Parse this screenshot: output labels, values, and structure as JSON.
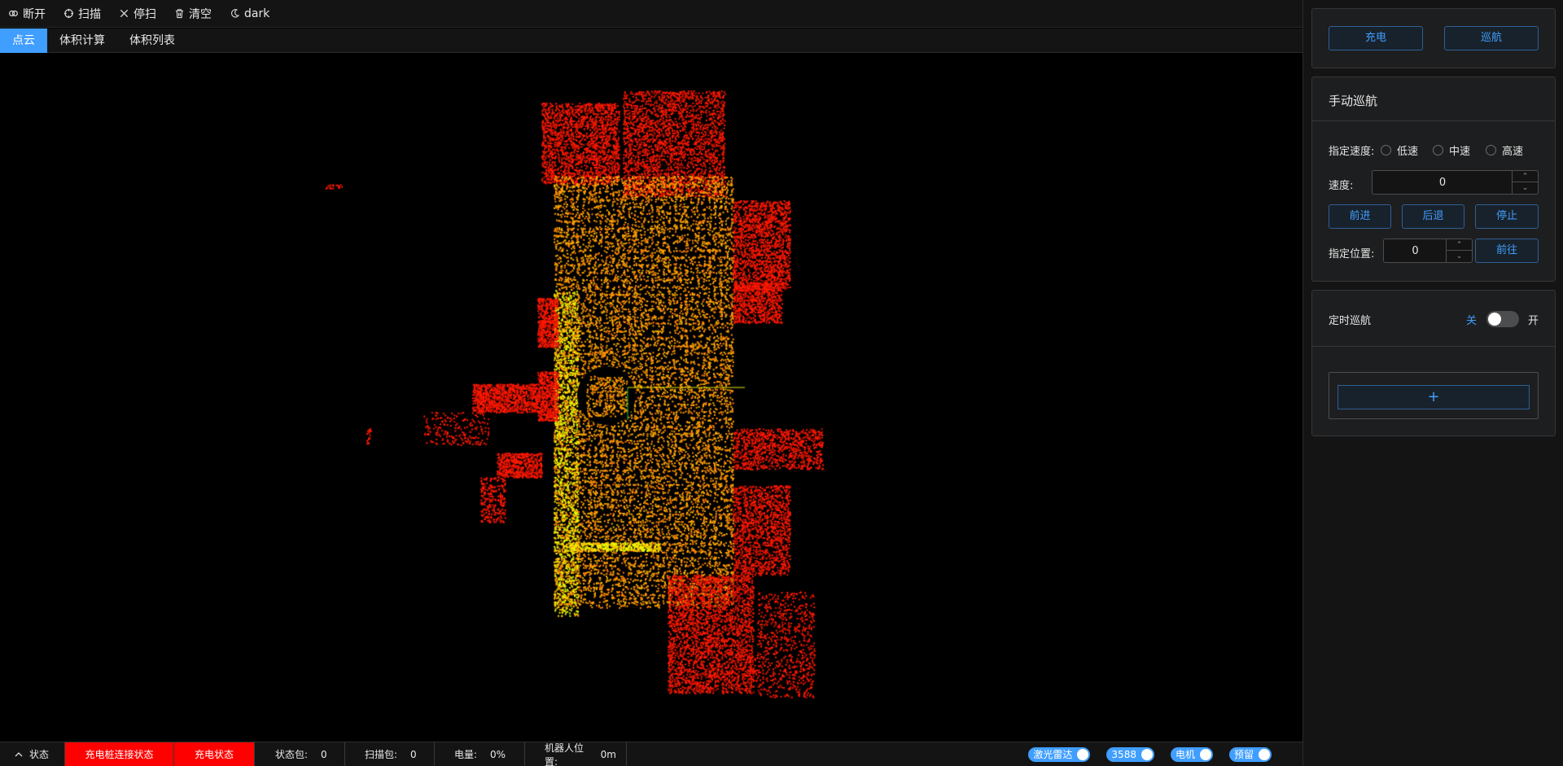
{
  "toolbar": {
    "items": [
      {
        "label": "断开",
        "icon": "disconnect-icon"
      },
      {
        "label": "扫描",
        "icon": "scan-icon"
      },
      {
        "label": "停扫",
        "icon": "close-icon"
      },
      {
        "label": "清空",
        "icon": "trash-icon"
      },
      {
        "label": "dark",
        "icon": "moon-icon"
      }
    ]
  },
  "tabs": [
    {
      "label": "点云",
      "active": true
    },
    {
      "label": "体积计算",
      "active": false
    },
    {
      "label": "体积列表",
      "active": false
    }
  ],
  "colors": {
    "accent": "#409eff",
    "alert": "#ff0000",
    "panel_bg": "#141414",
    "card_bg": "#1d1e1f",
    "point_cloud_low": "#ff1a00",
    "point_cloud_mid": "#ff9900",
    "point_cloud_high": "#e6ff00"
  },
  "statusbar": {
    "toggle_label": "状态",
    "charge_dock_status": "充电桩连接状态",
    "charge_status": "充电状态",
    "status_packet_label": "状态包:",
    "status_packet_value": "0",
    "scan_packet_label": "扫描包:",
    "scan_packet_value": "0",
    "battery_label": "电量:",
    "battery_value": "0%",
    "robot_position_label": "机器人位置:",
    "robot_position_value": "0m",
    "switches": [
      "激光雷达",
      "3588",
      "电机",
      "预留"
    ]
  },
  "panel": {
    "charge_button": "充电",
    "patrol_button": "巡航",
    "manual": {
      "title": "手动巡航",
      "speed_preset_label": "指定速度:",
      "speed_options": [
        "低速",
        "中速",
        "高速"
      ],
      "speed_label": "速度:",
      "speed_value": "0",
      "forward_button": "前进",
      "backward_button": "后退",
      "stop_button": "停止",
      "position_label": "指定位置:",
      "position_value": "0",
      "goto_button": "前往"
    },
    "timed": {
      "title": "定时巡航",
      "off_label": "关",
      "on_label": "开",
      "add_button": "+"
    }
  }
}
